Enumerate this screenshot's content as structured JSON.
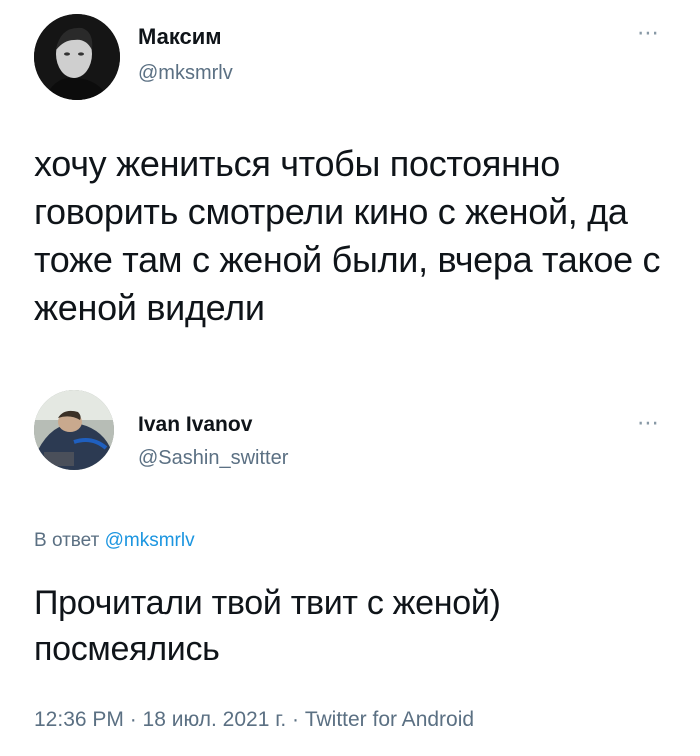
{
  "tweet": {
    "author_name": "Максим",
    "author_handle": "@mksmrlv",
    "more_icon": "⋯",
    "text": "хочу жениться чтобы постоянно говорить смотрели кино с женой, да тоже там с женой были, вчера такое с женой видели"
  },
  "reply": {
    "author_name": "Ivan Ivanov",
    "author_handle": "@Sashin_switter",
    "more_icon": "⋯",
    "reply_prefix": "В ответ",
    "reply_mention": "@mksmrlv",
    "text": "Прочитали твой твит с женой) посмеялись",
    "timestamp": "12:36 PM · 18 июл. 2021 г. · Twitter for Android"
  },
  "colors": {
    "text": "#0f1419",
    "secondary": "#5b7083",
    "link": "#1b95e0"
  }
}
